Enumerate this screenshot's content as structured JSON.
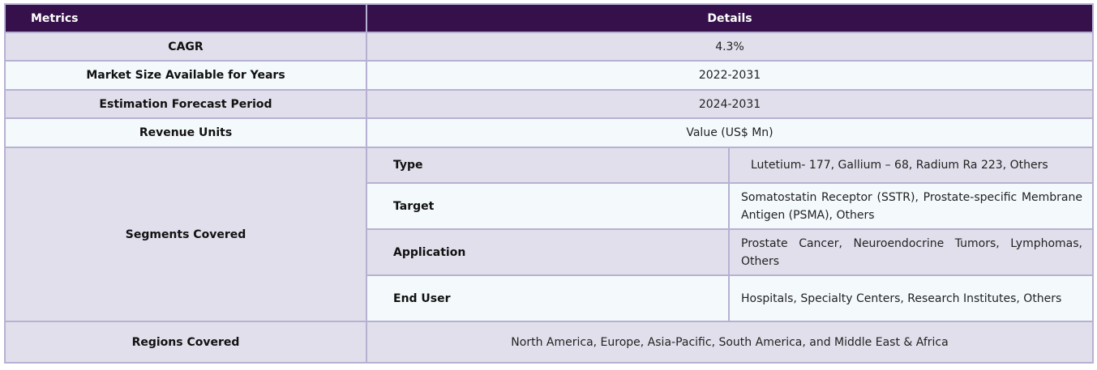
{
  "header": {
    "metrics_label": "Metrics",
    "details_label": "Details"
  },
  "rows": {
    "cagr": {
      "label": "CAGR",
      "value": "4.3%"
    },
    "market_size_years": {
      "label": "Market Size Available for Years",
      "value": "2022-2031"
    },
    "forecast_period": {
      "label": "Estimation Forecast Period",
      "value": "2024-2031"
    },
    "revenue_units": {
      "label": "Revenue Units",
      "value": "Value (US$ Mn)"
    },
    "segments": {
      "label": "Segments Covered",
      "items": [
        {
          "label": "Type",
          "value": "Lutetium- 177, Gallium – 68, Radium Ra 223, Others"
        },
        {
          "label": "Target",
          "value": "Somatostatin Receptor (SSTR), Prostate-specific Membrane Antigen (PSMA), Others"
        },
        {
          "label": "Application",
          "value": "Prostate Cancer, Neuroendocrine Tumors, Lymphomas, Others"
        },
        {
          "label": "End User",
          "value": "Hospitals, Specialty Centers, Research Institutes, Others"
        }
      ]
    },
    "regions": {
      "label": "Regions Covered",
      "value": "North America, Europe, Asia-Pacific, South America, and Middle East & Africa"
    }
  },
  "colors": {
    "header_bg": "#35104b",
    "header_text": "#ffffff",
    "row_shade": "#e1dfeb",
    "row_light": "#f4f9fc",
    "border": "#b6b1d2"
  }
}
